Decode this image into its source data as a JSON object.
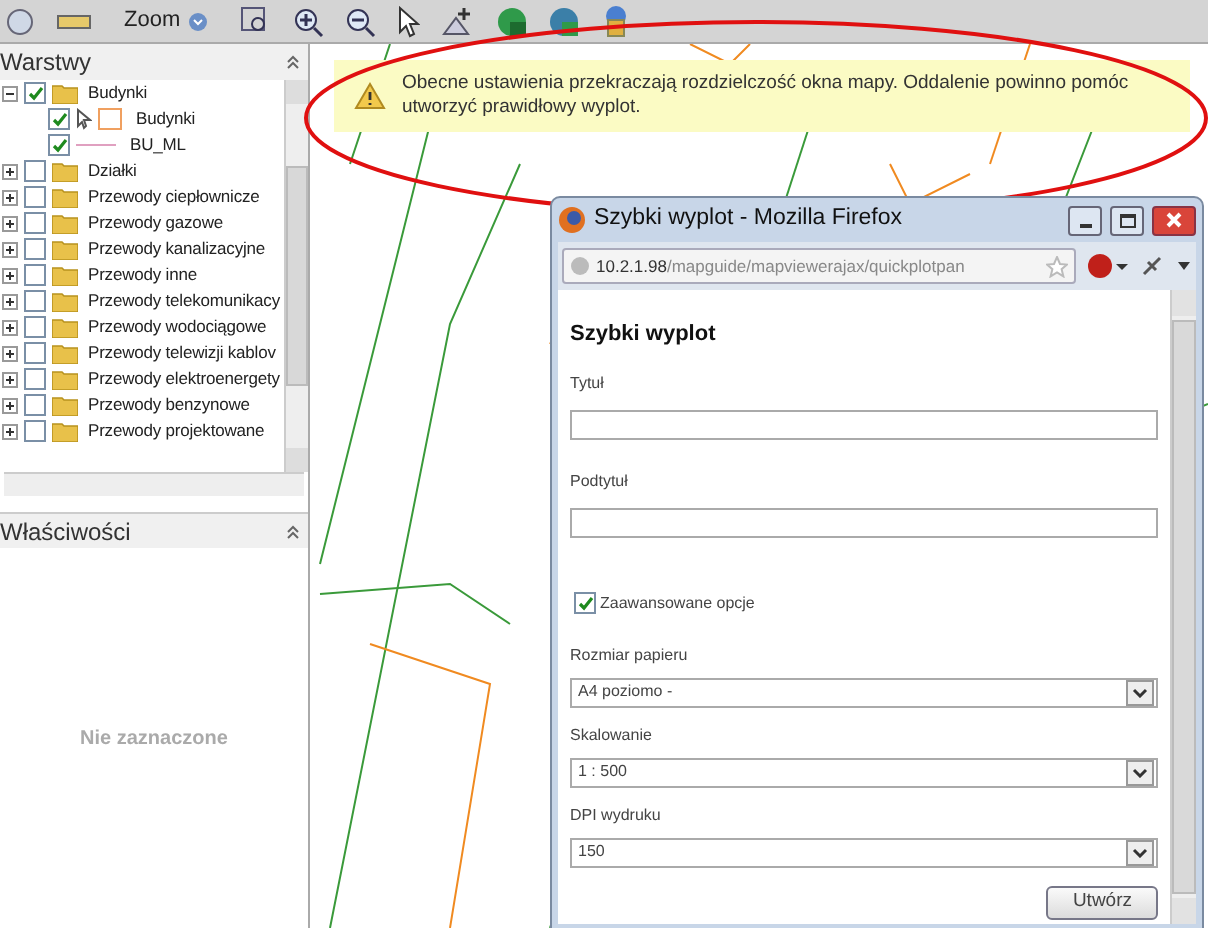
{
  "toolbar": {
    "zoom_label": "Zoom"
  },
  "layers_panel": {
    "title": "Warstwy",
    "items": [
      {
        "label": "Budynki",
        "checked": true,
        "expanded": true,
        "children": [
          {
            "label": "Budynki",
            "checked": true,
            "kind": "style"
          },
          {
            "label": "BU_ML",
            "checked": true,
            "kind": "line"
          }
        ]
      },
      {
        "label": "Działki",
        "checked": false,
        "expanded": false
      },
      {
        "label": "Przewody ciepłownicze",
        "checked": false,
        "expanded": false
      },
      {
        "label": "Przewody gazowe",
        "checked": false,
        "expanded": false
      },
      {
        "label": "Przewody kanalizacyjne",
        "checked": false,
        "expanded": false
      },
      {
        "label": "Przewody inne",
        "checked": false,
        "expanded": false
      },
      {
        "label": "Przewody telekomunikacy",
        "checked": false,
        "expanded": false
      },
      {
        "label": "Przewody wodociągowe",
        "checked": false,
        "expanded": false
      },
      {
        "label": "Przewody telewizji kablov",
        "checked": false,
        "expanded": false
      },
      {
        "label": "Przewody elektroenergety",
        "checked": false,
        "expanded": false
      },
      {
        "label": "Przewody benzynowe",
        "checked": false,
        "expanded": false
      },
      {
        "label": "Przewody projektowane",
        "checked": false,
        "expanded": false
      }
    ]
  },
  "properties_panel": {
    "title": "Właściwości",
    "empty_text": "Nie zaznaczone"
  },
  "notice": {
    "text": "Obecne ustawienia przekraczają rozdzielczość okna mapy. Oddalenie powinno pomóc utworzyć prawidłowy wyplot."
  },
  "popup": {
    "title": "Szybki wyplot - Mozilla Firefox",
    "url_host": "10.2.1.98",
    "url_path": "/mapguide/mapviewerajax/quickplotpan",
    "heading": "Szybki wyplot",
    "fields": [
      {
        "kind": "text",
        "label": "Tytuł"
      },
      {
        "kind": "text",
        "label": "Podtytuł"
      },
      {
        "kind": "checkbox",
        "label": "Zaawansowane opcje",
        "checked": true
      },
      {
        "kind": "select",
        "label": "Rozmiar papieru",
        "value": "A4 poziomo -"
      },
      {
        "kind": "select",
        "label": "Skalowanie",
        "value": "1 : 500"
      },
      {
        "kind": "select",
        "label": "DPI wydruku",
        "value": "150"
      }
    ],
    "button": "Utwórz"
  }
}
